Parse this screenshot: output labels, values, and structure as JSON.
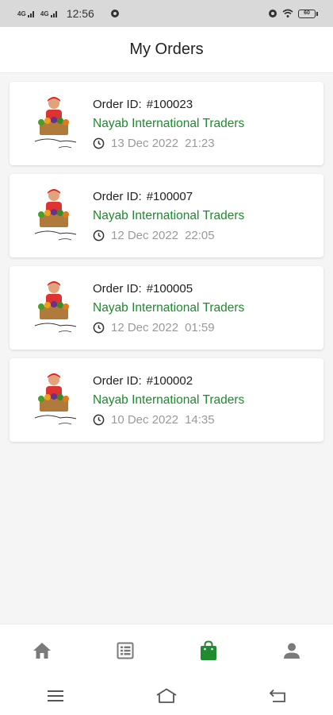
{
  "status_bar": {
    "net1": "4G",
    "net2": "4G",
    "time": "12:56",
    "battery": "60"
  },
  "header": {
    "title": "My Orders"
  },
  "colors": {
    "accent": "#1f8a2e",
    "muted": "#9a9a9a",
    "icon_gray": "#7a7a7a"
  },
  "orders": [
    {
      "id_label": "Order ID:",
      "id": "#100023",
      "vendor": "Nayab International Traders",
      "date": "13 Dec 2022",
      "time": "21:23"
    },
    {
      "id_label": "Order ID:",
      "id": "#100007",
      "vendor": "Nayab International Traders",
      "date": "12 Dec 2022",
      "time": "22:05"
    },
    {
      "id_label": "Order ID:",
      "id": "#100005",
      "vendor": "Nayab International Traders",
      "date": "12 Dec 2022",
      "time": "01:59"
    },
    {
      "id_label": "Order ID:",
      "id": "#100002",
      "vendor": "Nayab International Traders",
      "date": "10 Dec 2022",
      "time": "14:35"
    }
  ],
  "bottom_nav": {
    "active": "orders",
    "items": [
      {
        "icon": "home-icon"
      },
      {
        "icon": "list-icon"
      },
      {
        "icon": "shopping-bag-icon"
      },
      {
        "icon": "person-icon"
      }
    ]
  },
  "system_nav": {
    "items": [
      {
        "icon": "menu-icon"
      },
      {
        "icon": "home-outline-icon"
      },
      {
        "icon": "back-icon"
      }
    ]
  }
}
